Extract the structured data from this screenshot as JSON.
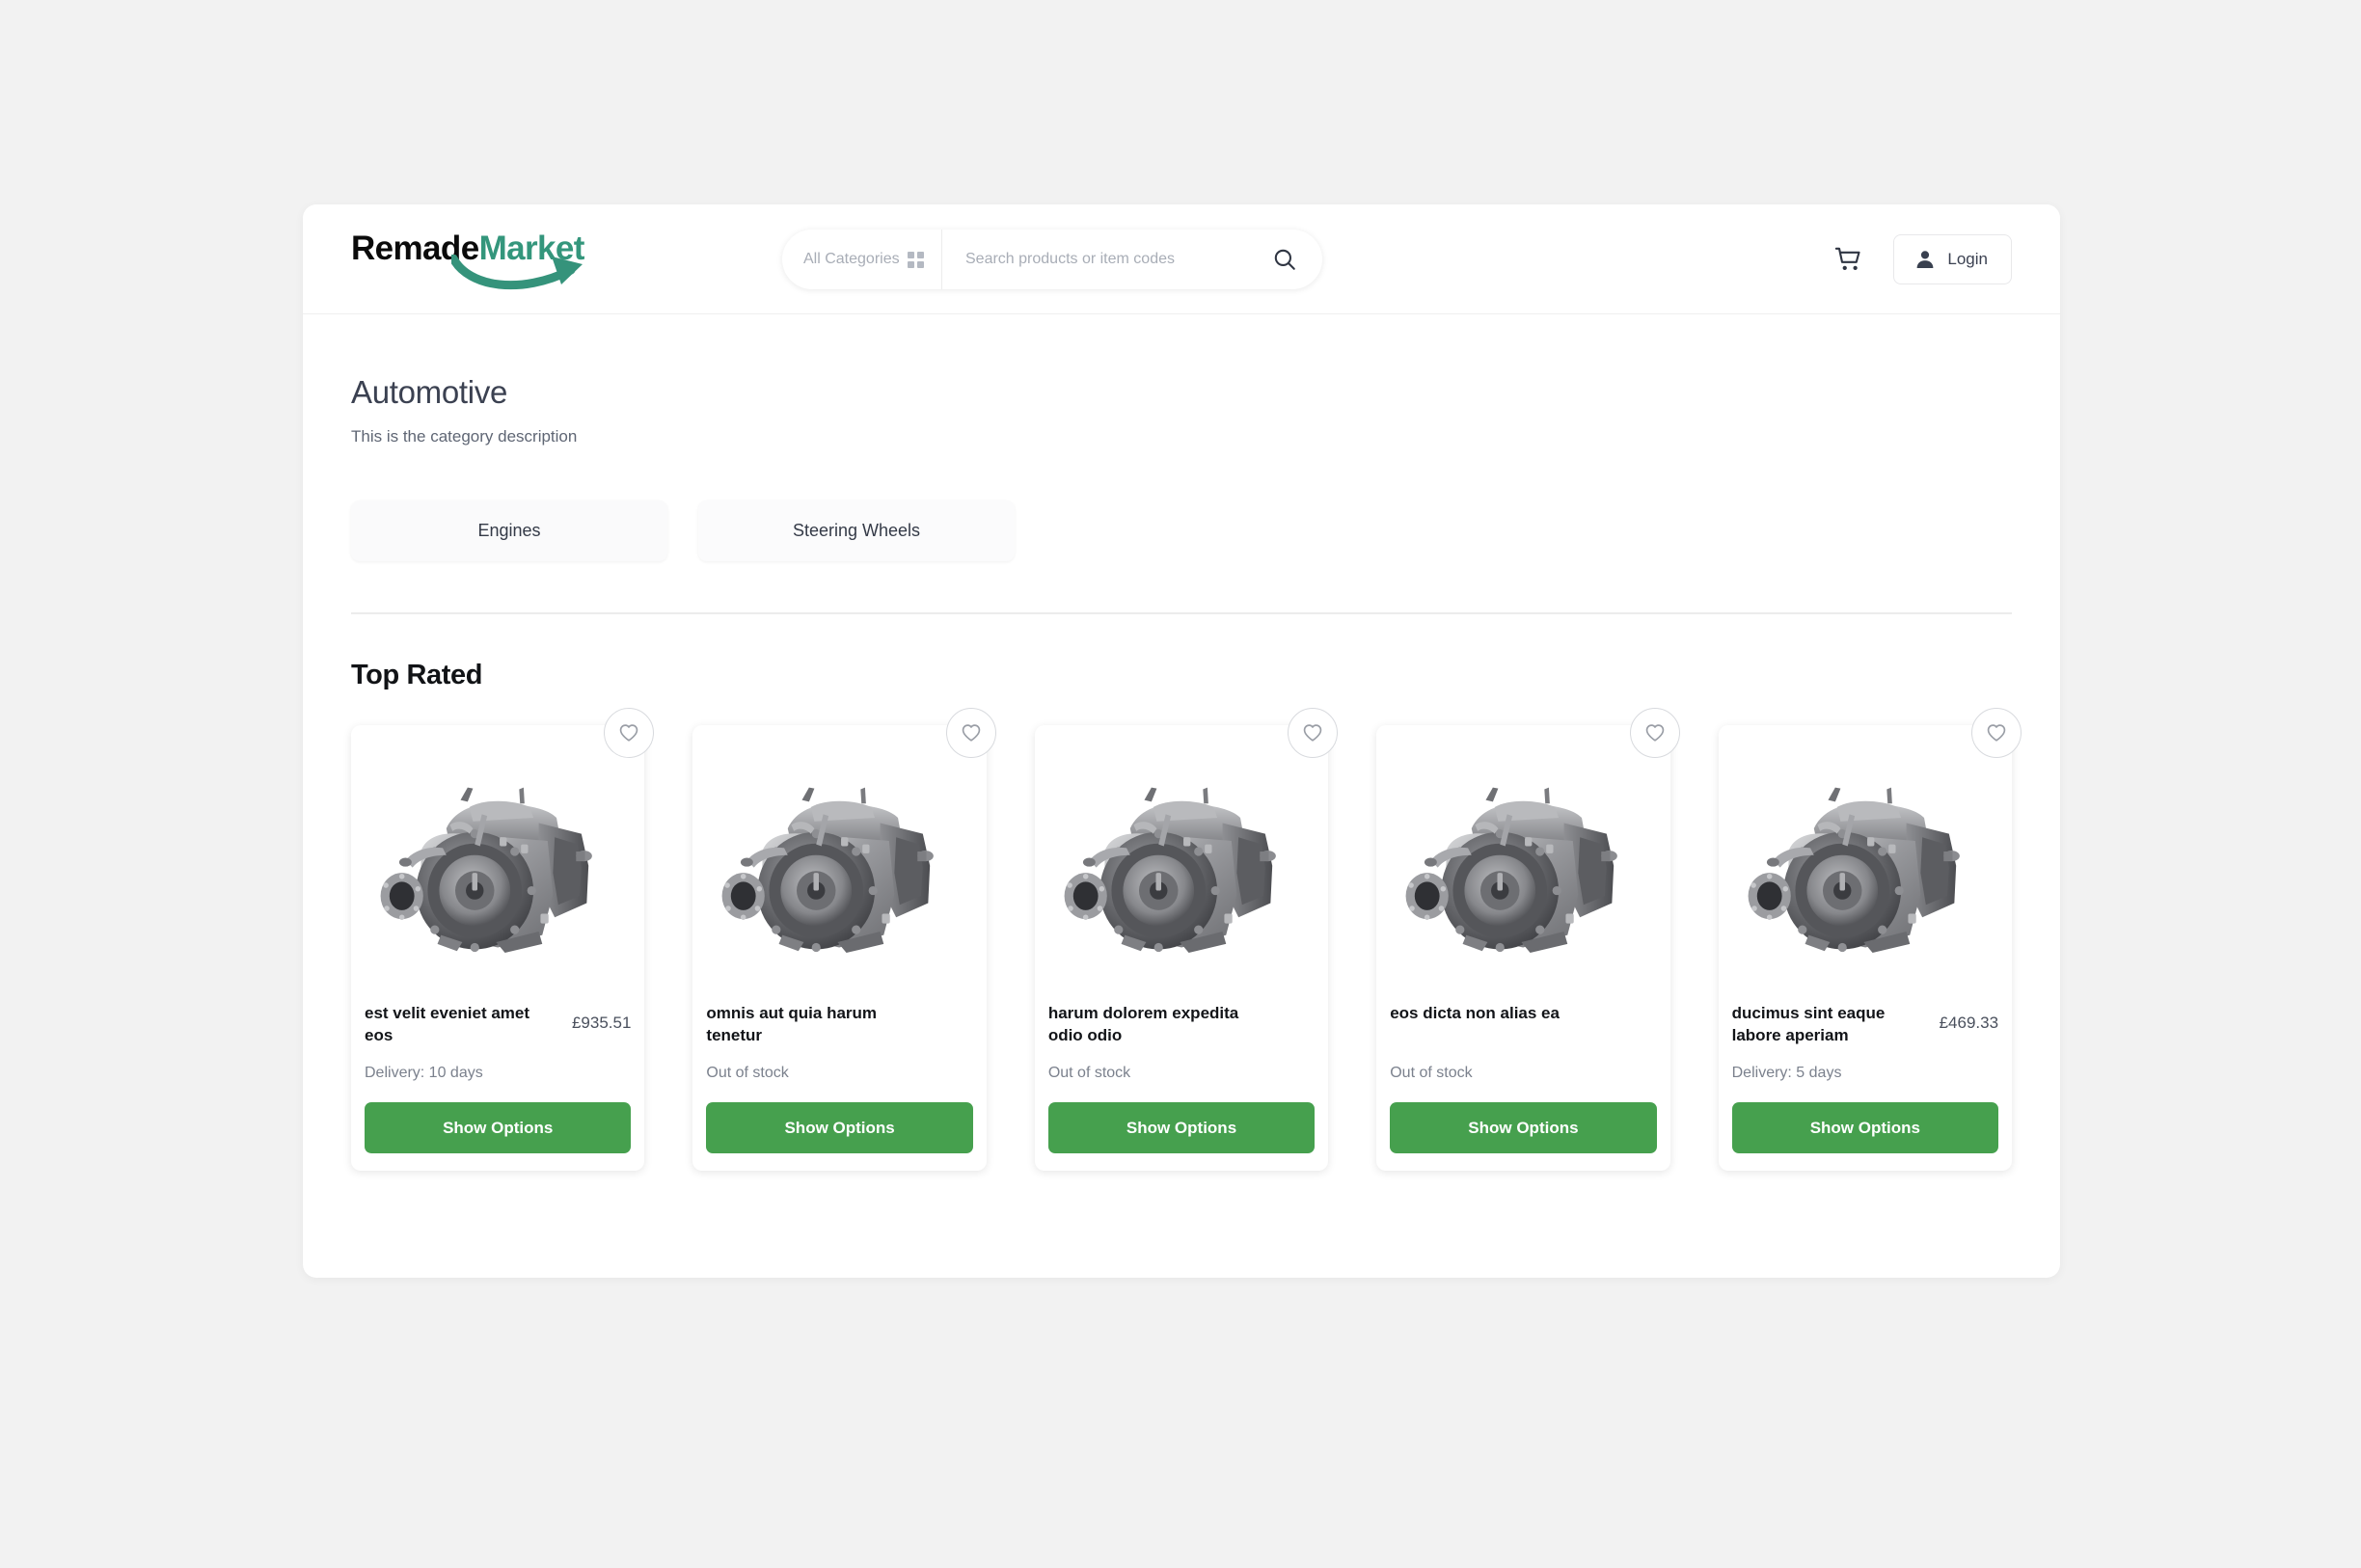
{
  "brand": {
    "name_part1": "Remade",
    "name_part2": "Market",
    "color_part1": "#0b0b0b",
    "color_part2": "#34967c"
  },
  "search": {
    "category_placeholder": "All Categories",
    "category_value": "",
    "input_placeholder": "Search products or item codes",
    "input_value": ""
  },
  "header": {
    "cart_icon": "shopping-cart-icon",
    "login_label": "Login",
    "login_icon": "person-icon"
  },
  "category": {
    "title": "Automotive",
    "description": "This is the category description",
    "subcategories": [
      {
        "label": "Engines"
      },
      {
        "label": "Steering Wheels"
      }
    ]
  },
  "top_rated": {
    "heading": "Top Rated",
    "button_color": "#46a04e",
    "products": [
      {
        "name": "est velit eveniet amet eos",
        "price": "£935.51",
        "stock": "Delivery: 10 days",
        "action": "Show Options",
        "favourite_icon": "heart-icon",
        "image": "engine-photo"
      },
      {
        "name": "omnis aut quia harum tenetur",
        "price": "",
        "stock": "Out of stock",
        "action": "Show Options",
        "favourite_icon": "heart-icon",
        "image": "engine-photo"
      },
      {
        "name": "harum dolorem expedita odio odio",
        "price": "",
        "stock": "Out of stock",
        "action": "Show Options",
        "favourite_icon": "heart-icon",
        "image": "engine-photo"
      },
      {
        "name": "eos dicta non alias ea",
        "price": "",
        "stock": "Out of stock",
        "action": "Show Options",
        "favourite_icon": "heart-icon",
        "image": "engine-photo"
      },
      {
        "name": "ducimus sint eaque labore aperiam",
        "price": "£469.33",
        "stock": "Delivery: 5 days",
        "action": "Show Options",
        "favourite_icon": "heart-icon",
        "image": "engine-photo"
      }
    ]
  }
}
